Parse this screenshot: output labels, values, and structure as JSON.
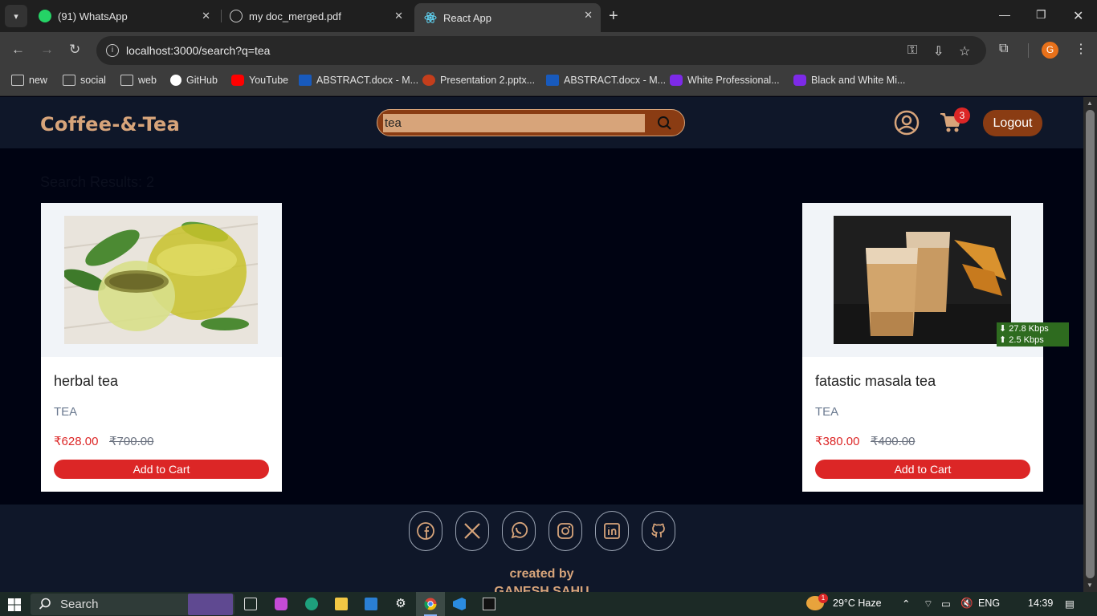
{
  "browser": {
    "tabs": [
      {
        "label": "(91) WhatsApp",
        "icon": "whatsapp-icon",
        "badge": "91"
      },
      {
        "label": "my doc_merged.pdf",
        "icon": "globe-icon"
      },
      {
        "label": "React App",
        "icon": "react-icon"
      }
    ],
    "url": "localhost:3000/search?q=tea",
    "bookmarks": [
      {
        "label": "new",
        "icon": "folder-icon"
      },
      {
        "label": "social",
        "icon": "folder-icon"
      },
      {
        "label": "web",
        "icon": "folder-icon"
      },
      {
        "label": "GitHub",
        "icon": "github-icon"
      },
      {
        "label": "YouTube",
        "icon": "youtube-icon"
      },
      {
        "label": "ABSTRACT.docx - M...",
        "icon": "word-icon"
      },
      {
        "label": "Presentation 2.pptx...",
        "icon": "powerpoint-icon"
      },
      {
        "label": "ABSTRACT.docx - M...",
        "icon": "word-icon"
      },
      {
        "label": "White Professional...",
        "icon": "canva-icon"
      },
      {
        "label": "Black and White Mi...",
        "icon": "canva-icon"
      }
    ],
    "profile_initial": "G"
  },
  "header": {
    "brand": "Coffee-&-Tea",
    "search_value": "tea",
    "cart_count": "3",
    "logout_label": "Logout"
  },
  "results": {
    "title": "Search Results: 2",
    "products": [
      {
        "name": "herbal tea",
        "category": "TEA",
        "price": "₹628.00",
        "mrp": "₹700.00",
        "button": "Add to Cart"
      },
      {
        "name": "fatastic masala tea",
        "category": "TEA",
        "price": "₹380.00",
        "mrp": "₹400.00",
        "button": "Add to Cart"
      }
    ]
  },
  "footer": {
    "social_icons": [
      "facebook-icon",
      "x-icon",
      "whatsapp-icon",
      "instagram-icon",
      "linkedin-icon",
      "github-icon"
    ],
    "credit_line1": "created by",
    "credit_line2": "GANESH SAHU"
  },
  "netspeed": {
    "down": "⬇ 27.8 Kbps",
    "up": "⬆ 2.5 Kbps"
  },
  "taskbar": {
    "search_label": "Search",
    "weather": "29°C  Haze",
    "language": "ENG",
    "time": "14:39",
    "weather_badge": "1"
  },
  "colors": {
    "accent": "#d7a47a",
    "brown": "#8a3c13",
    "red": "#dc2626",
    "navy": "#0f1729"
  }
}
